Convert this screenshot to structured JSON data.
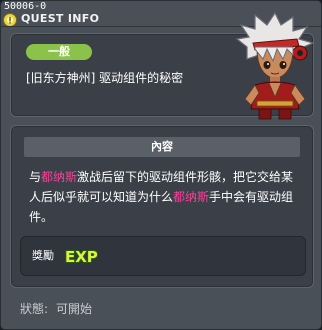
{
  "window": {
    "quest_id": "50006-0",
    "title": "QUEST INFO",
    "title_icon": "quest-info-icon"
  },
  "header": {
    "category_tag": "一般",
    "quest_name": "[旧东方神州] 驱动组件的秘密",
    "portrait": "npc-portrait"
  },
  "content": {
    "section_title": "內容",
    "description_parts": [
      {
        "text": "与",
        "highlight": false
      },
      {
        "text": "都纳斯",
        "highlight": true
      },
      {
        "text": "激战后留下的驱动组件形骸，把它交给某人后似乎就可以知道为什么",
        "highlight": false
      },
      {
        "text": "都纳斯",
        "highlight": true
      },
      {
        "text": "手中会有驱动组件。",
        "highlight": false
      }
    ],
    "highlight_color": "#ff3d9a",
    "reward_label": "獎勵",
    "reward_icon": "exp-icon",
    "reward_icon_text": "EXP"
  },
  "status": {
    "label": "狀態:",
    "value": "可開始"
  },
  "colors": {
    "tag_bg": "#8bc34a",
    "panel_bg": "#3b4048",
    "window_bg": "#4a5058"
  }
}
